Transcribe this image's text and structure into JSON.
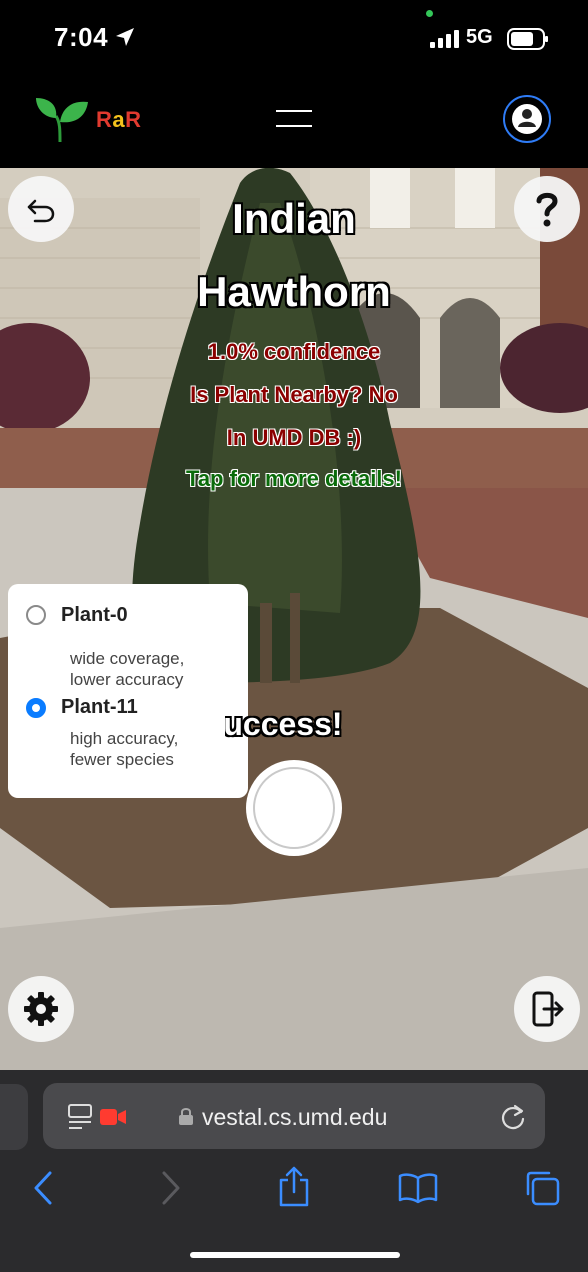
{
  "status": {
    "time": "7:04",
    "network": "5G"
  },
  "app": {
    "brand_r1": "R",
    "brand_a": "a",
    "brand_r2": "R"
  },
  "result": {
    "name_line1": "Indian",
    "name_line2": "Hawthorn",
    "confidence": "1.0% confidence",
    "nearby": "Is Plant Nearby? No",
    "db": "In UMD DB :)",
    "details": "Tap for more details!",
    "status": "Success!"
  },
  "models": [
    {
      "label": "Plant-0",
      "desc1": "wide coverage,",
      "desc2": "lower accuracy",
      "selected": false
    },
    {
      "label": "Plant-11",
      "desc1": "high accuracy,",
      "desc2": "fewer species",
      "selected": true
    }
  ],
  "browser": {
    "url": "vestal.cs.umd.edu"
  },
  "colors": {
    "accent": "#0a7cff",
    "brand_red": "#e03a2f",
    "brand_yellow": "#f3c11d",
    "confidence_red": "#8b0000",
    "details_green": "#0a6b0a"
  },
  "icons": [
    "location-arrow-icon",
    "signal-icon",
    "battery-icon",
    "leaf-logo-icon",
    "hamburger-icon",
    "profile-icon",
    "undo-icon",
    "help-icon",
    "settings-gear-icon",
    "exit-device-icon",
    "reader-icon",
    "record-icon",
    "lock-icon",
    "reload-icon",
    "back-icon",
    "forward-icon",
    "share-icon",
    "bookmarks-icon",
    "tabs-icon"
  ]
}
